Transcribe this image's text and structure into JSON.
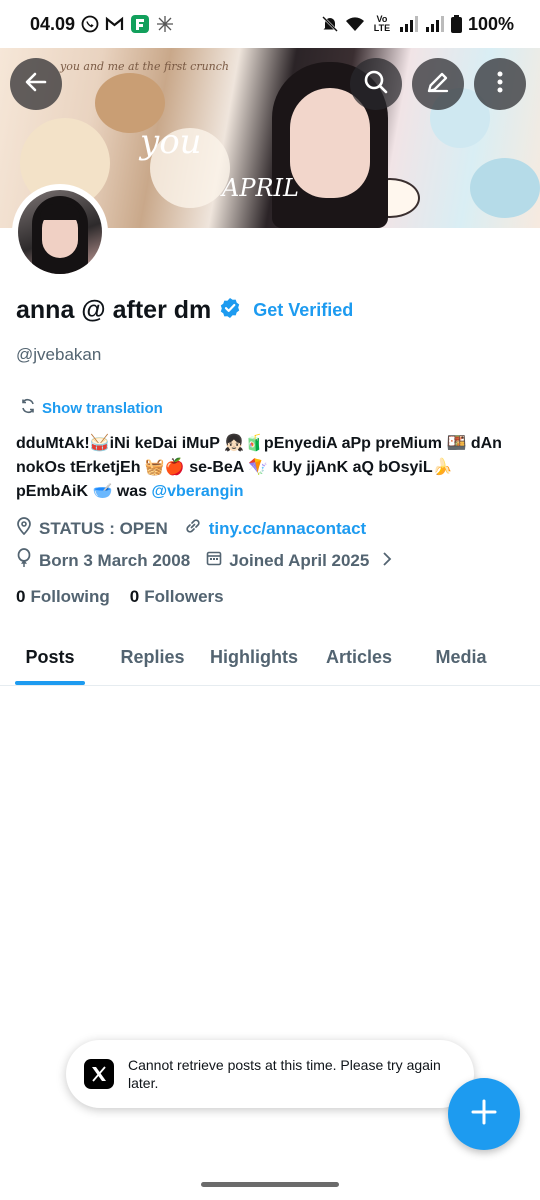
{
  "status_bar": {
    "time": "04.09",
    "volte": "Vo LTE",
    "battery": "100%"
  },
  "banner": {
    "text_you": "you",
    "text_april": "APRIL",
    "text_small": "you and me at the first crunch"
  },
  "profile": {
    "display_name": "anna @ after dm",
    "get_verified": "Get Verified",
    "handle": "@jvebakan",
    "show_translation": "Show translation",
    "bio_text": "dduMtAk!🥁iNi keDai iMuP 👧🏻🧃pEnyediA aPp preMium 🍱 dAn nokOs tErketjEh 🧺🍎 se-BeA 🪁 kUy jjAnK aQ bOsyiL🍌 pEmbAiK 🥣 was ",
    "bio_mention": "@vberangin",
    "location": "STATUS : OPEN",
    "website": "tiny.cc/annacontact",
    "born": "Born 3 March 2008",
    "joined": "Joined April 2025",
    "following_count": "0",
    "following_label": "Following",
    "followers_count": "0",
    "followers_label": "Followers"
  },
  "tabs": [
    {
      "label": "Posts"
    },
    {
      "label": "Replies"
    },
    {
      "label": "Highlights"
    },
    {
      "label": "Articles"
    },
    {
      "label": "Media"
    }
  ],
  "toast": {
    "message": "Cannot retrieve posts at this time. Please try again later."
  },
  "colors": {
    "accent": "#1d9bf0",
    "text": "#0f1419",
    "muted": "#536471"
  },
  "icons": {
    "back": "back-arrow-icon",
    "search": "search-icon",
    "edit": "edit-pencil-icon",
    "more": "more-vertical-icon",
    "verified": "verified-badge-icon",
    "translate": "translate-icon",
    "location": "location-pin-icon",
    "link": "link-icon",
    "birthday": "balloon-icon",
    "calendar": "calendar-icon",
    "chevron": "chevron-right-icon",
    "compose": "plus-icon",
    "x_logo": "x-logo-icon"
  }
}
